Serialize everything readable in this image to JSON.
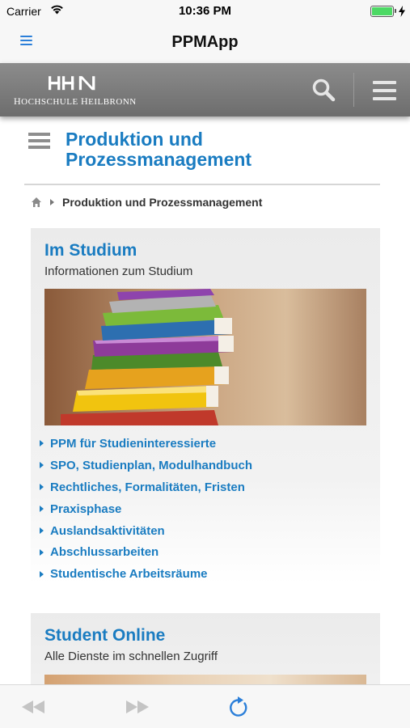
{
  "status_bar": {
    "carrier": "Carrier",
    "time": "10:36 PM",
    "battery_level": 1.0
  },
  "nav_bar": {
    "title": "PPMApp",
    "menu_icon": "menu-icon"
  },
  "site_header": {
    "logo_text": "HHN",
    "logo_subtitle_h": "H",
    "logo_subtitle_1": "OCHSCHULE ",
    "logo_subtitle_h2": "H",
    "logo_subtitle_2": "EILBRONN",
    "search_icon": "search-icon",
    "menu_icon": "hamburger-icon"
  },
  "page": {
    "title": "Produktion und Prozessmanagement",
    "breadcrumb": {
      "home_icon": "home-icon",
      "current": "Produktion und Prozessmanagement"
    }
  },
  "cards": [
    {
      "title": "Im Studium",
      "subtitle": "Informationen zum Studium",
      "links": [
        "PPM für Studieninteressierte",
        "SPO, Studienplan, Modulhandbuch",
        "Rechtliches, Formalitäten, Fristen",
        "Praxisphase",
        "Auslandsaktivitäten",
        "Abschlussarbeiten",
        "Studentische Arbeitsräume"
      ]
    },
    {
      "title": "Student Online",
      "subtitle": "Alle Dienste im schnellen Zugriff"
    }
  ],
  "toolbar": {
    "back_icon": "rewind-icon",
    "forward_icon": "fast-forward-icon",
    "reload_icon": "reload-icon"
  },
  "colors": {
    "link_blue": "#1a7cc1",
    "ios_blue": "#2b7fd9",
    "header_gray": "#7a7a7a",
    "battery_green": "#4cd964"
  }
}
